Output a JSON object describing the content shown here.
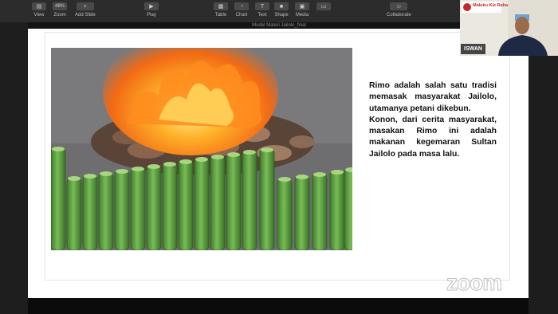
{
  "toolbar": {
    "items": [
      {
        "label": "View"
      },
      {
        "label": "Zoom",
        "value": "48%"
      },
      {
        "label": "Add Slide"
      },
      {
        "label": "Play"
      },
      {
        "label": "Table"
      },
      {
        "label": "Chart"
      },
      {
        "label": "Text"
      },
      {
        "label": "Shape"
      },
      {
        "label": "Media"
      },
      {
        "label": "Collaborate"
      }
    ]
  },
  "document": {
    "title": "Model Materi Jailolo_final"
  },
  "slide": {
    "paragraph1": "Rimo adalah salah satu tradisi memasak masyarakat Jailolo, utamanya petani dikebun.",
    "paragraph2": "Konon, dari cerita masyarakat, masakan Rimo ini adalah makanan kegemaran Sultan Jailolo pada masa lalu."
  },
  "participant": {
    "name": "ISWAN",
    "banner": "Maluku Kie Raha"
  },
  "watermark": {
    "text": "zoom"
  },
  "colors": {
    "bamboo": "#6fb24f",
    "fire": "#f27a1a",
    "background": "#141414"
  }
}
